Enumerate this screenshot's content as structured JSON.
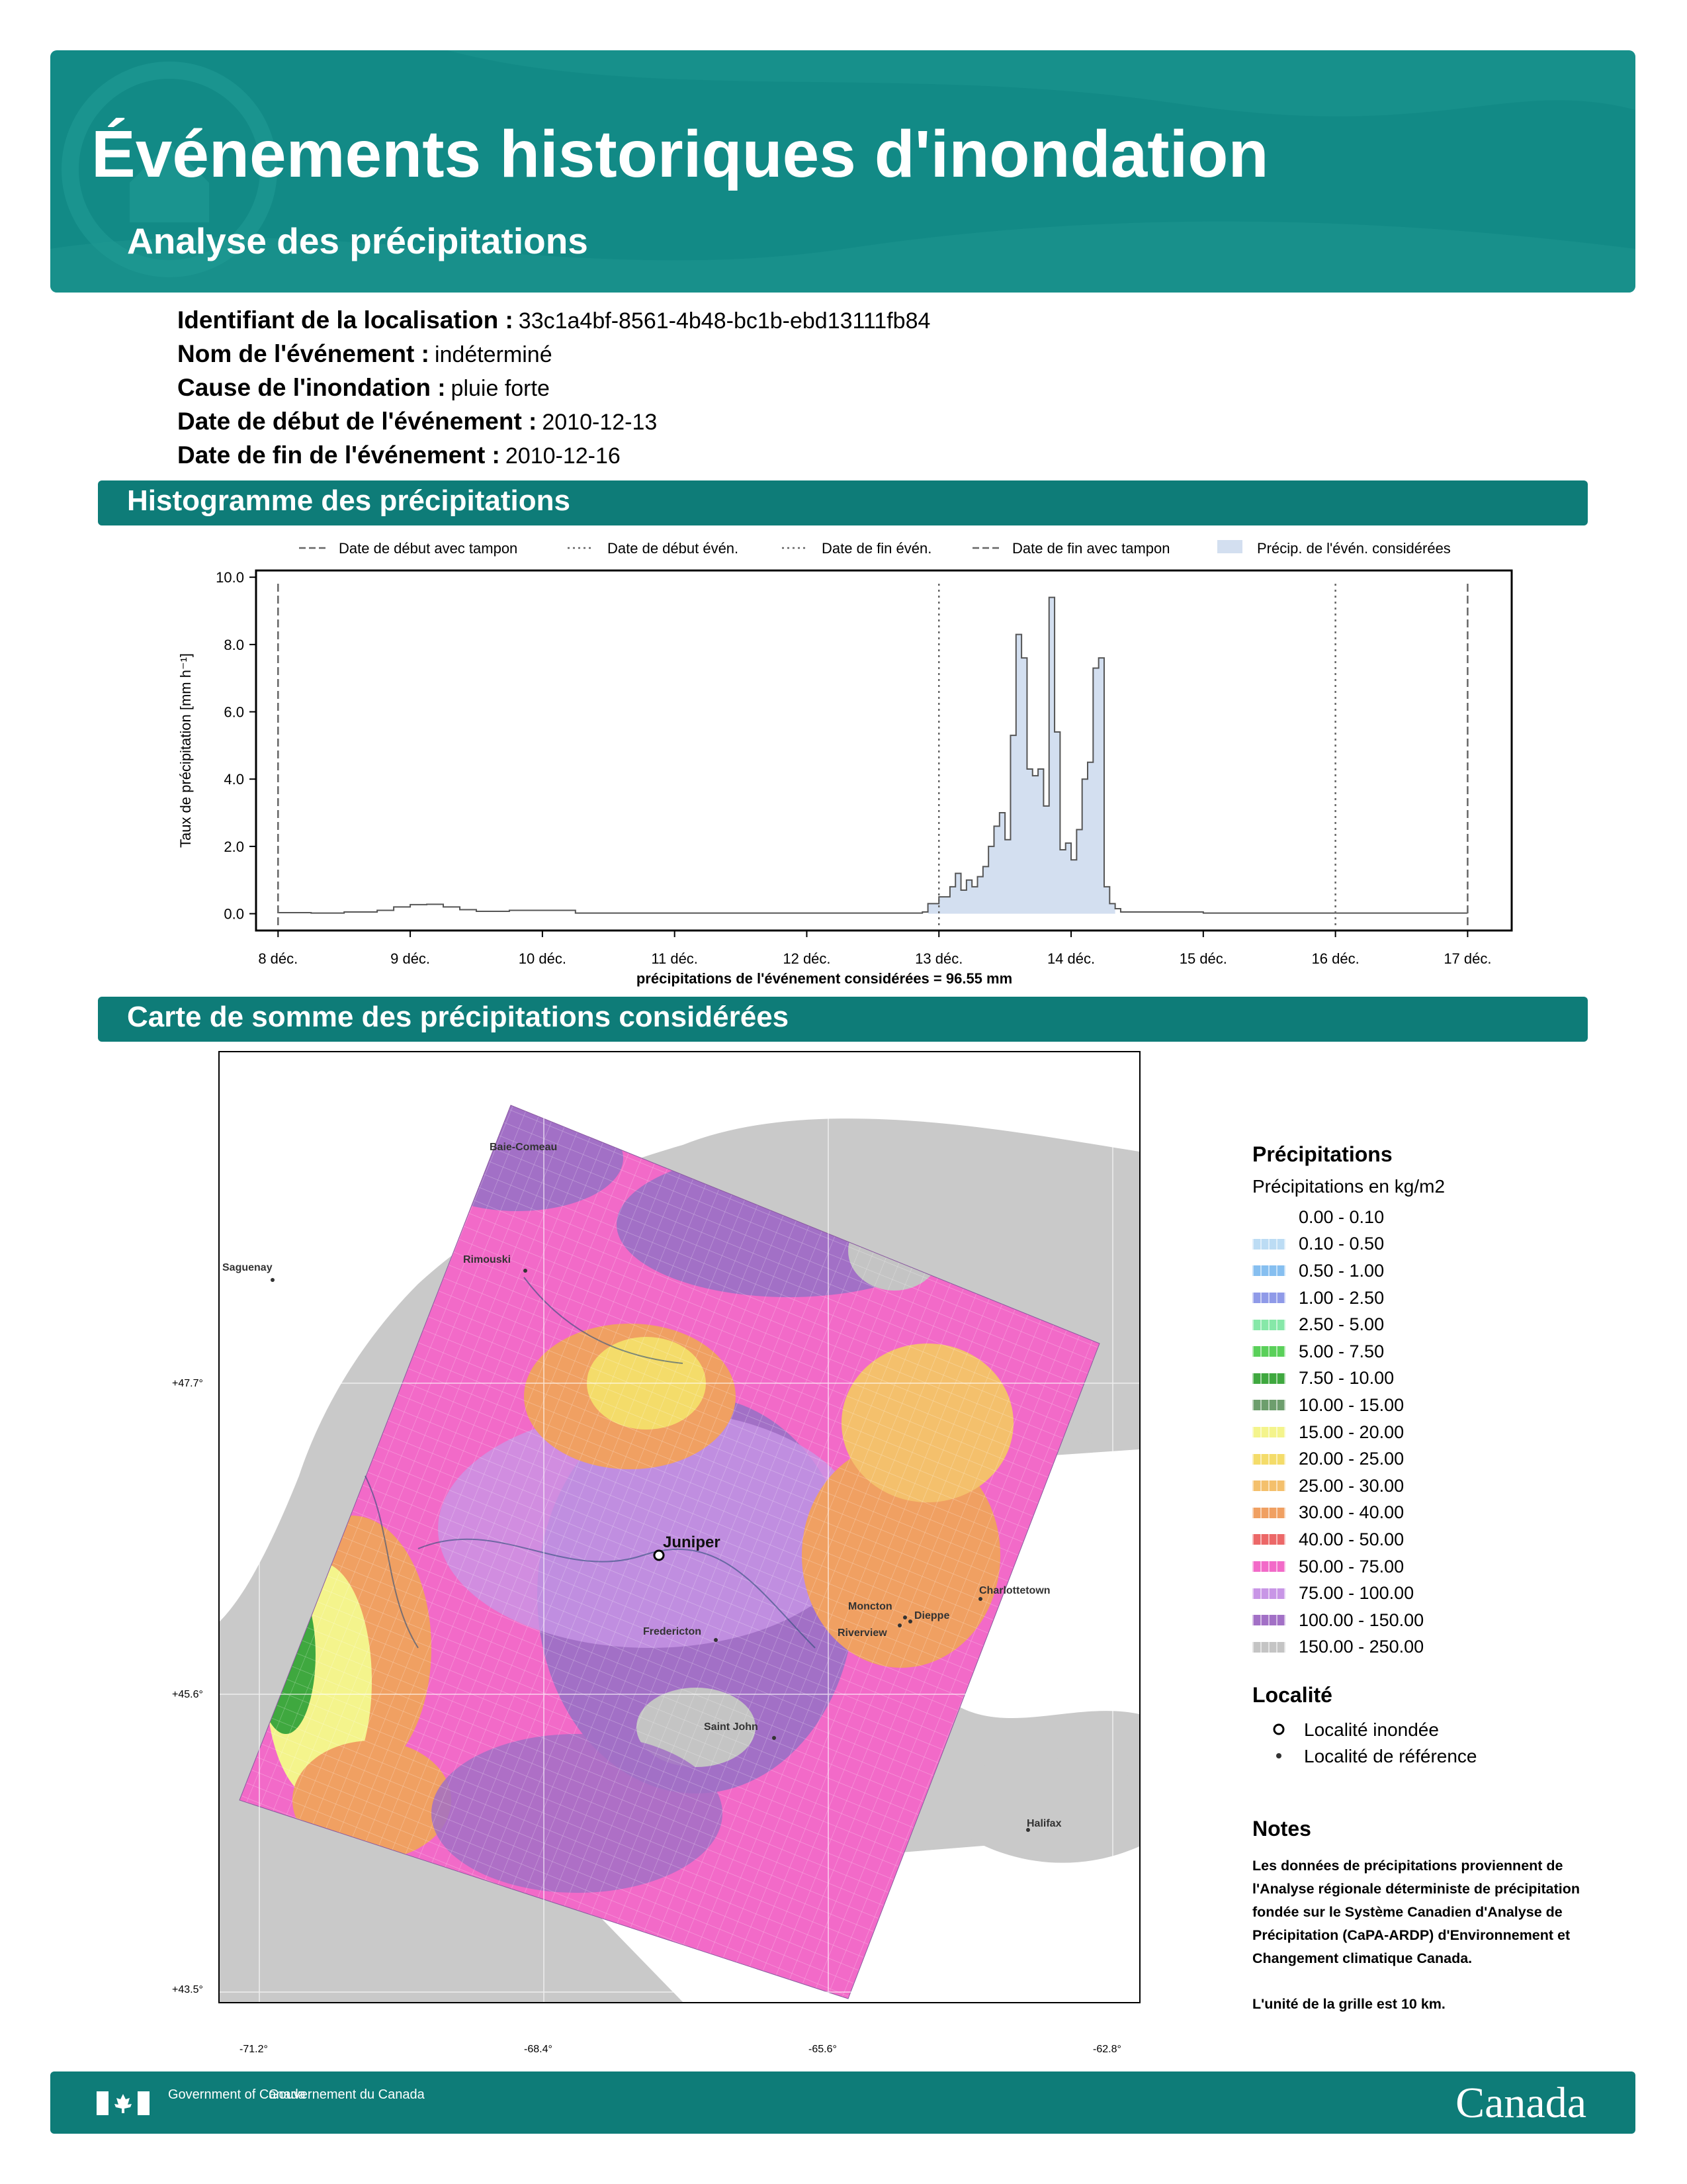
{
  "header": {
    "title": "Événements historiques d'inondation",
    "subtitle": "Analyse des précipitations",
    "bg_color": "#128a86"
  },
  "info": [
    {
      "label": "Identifiant de la localisation :",
      "value": "33c1a4bf-8561-4b48-bc1b-ebd13111fb84"
    },
    {
      "label": "Nom de l'événement :",
      "value": "indéterminé"
    },
    {
      "label": "Cause de l'inondation :",
      "value": "pluie forte"
    },
    {
      "label": "Date de début de l'événement :",
      "value": "2010-12-13"
    },
    {
      "label": "Date de fin de l'événement :",
      "value": "2010-12-16"
    }
  ],
  "sections": {
    "histogram": "Histogramme des précipitations",
    "map": "Carte de somme des précipitations considérées"
  },
  "chart_data": {
    "type": "area",
    "legend": [
      {
        "name": "Date de début avec tampon",
        "style": "dashed"
      },
      {
        "name": "Date de début évén.",
        "style": "dotted"
      },
      {
        "name": "Date de fin évén.",
        "style": "dotted"
      },
      {
        "name": "Date de fin avec tampon",
        "style": "dashed"
      },
      {
        "name": "Précip. de l'évén. considérées",
        "style": "fill"
      }
    ],
    "legend_position": "top",
    "ylabel": "Taux de précipitation [mm h⁻¹]",
    "xlabel": "précipitations de l'événement considérées = 96.55 mm",
    "xlim": [
      "2010-12-07 20:00",
      "2010-12-17 08:00"
    ],
    "ylim": [
      -0.5,
      10.2
    ],
    "y_ticks": [
      "0.0",
      "2.0",
      "4.0",
      "6.0",
      "8.0",
      "10.0"
    ],
    "x_ticks": [
      {
        "date": "2010-12-08",
        "label": "8 déc."
      },
      {
        "date": "2010-12-09",
        "label": "9 déc."
      },
      {
        "date": "2010-12-10",
        "label": "10 déc."
      },
      {
        "date": "2010-12-11",
        "label": "11 déc."
      },
      {
        "date": "2010-12-12",
        "label": "12 déc."
      },
      {
        "date": "2010-12-13",
        "label": "13 déc."
      },
      {
        "date": "2010-12-14",
        "label": "14 déc."
      },
      {
        "date": "2010-12-15",
        "label": "15 déc."
      },
      {
        "date": "2010-12-16",
        "label": "16 déc."
      },
      {
        "date": "2010-12-17",
        "label": "17 déc."
      }
    ],
    "vlines": [
      {
        "date": "2010-12-08 00:00",
        "style": "dashed"
      },
      {
        "date": "2010-12-13 00:00",
        "style": "dotted"
      },
      {
        "date": "2010-12-16 00:00",
        "style": "dotted"
      },
      {
        "date": "2010-12-17 00:00",
        "style": "dashed"
      }
    ],
    "series": [
      {
        "points": [
          [
            "2010-12-08 00:00",
            0.03
          ],
          [
            "2010-12-08 06:00",
            0.02
          ],
          [
            "2010-12-08 12:00",
            0.05
          ],
          [
            "2010-12-08 18:00",
            0.1
          ],
          [
            "2010-12-08 21:00",
            0.2
          ],
          [
            "2010-12-09 00:00",
            0.27
          ],
          [
            "2010-12-09 03:00",
            0.28
          ],
          [
            "2010-12-09 06:00",
            0.2
          ],
          [
            "2010-12-09 09:00",
            0.12
          ],
          [
            "2010-12-09 12:00",
            0.07
          ],
          [
            "2010-12-09 18:00",
            0.1
          ],
          [
            "2010-12-10 00:00",
            0.1
          ],
          [
            "2010-12-10 06:00",
            0.02
          ],
          [
            "2010-12-11 00:00",
            0.02
          ],
          [
            "2010-12-12 00:00",
            0.02
          ],
          [
            "2010-12-12 21:00",
            0.05
          ],
          [
            "2010-12-12 22:00",
            0.3
          ],
          [
            "2010-12-13 00:00",
            0.5
          ],
          [
            "2010-12-13 02:00",
            0.8
          ],
          [
            "2010-12-13 03:00",
            1.2
          ],
          [
            "2010-12-13 04:00",
            0.7
          ],
          [
            "2010-12-13 05:00",
            1.0
          ],
          [
            "2010-12-13 06:00",
            0.8
          ],
          [
            "2010-12-13 07:00",
            1.1
          ],
          [
            "2010-12-13 08:00",
            1.4
          ],
          [
            "2010-12-13 09:00",
            2.0
          ],
          [
            "2010-12-13 10:00",
            2.6
          ],
          [
            "2010-12-13 11:00",
            3.0
          ],
          [
            "2010-12-13 12:00",
            2.2
          ],
          [
            "2010-12-13 13:00",
            5.3
          ],
          [
            "2010-12-13 14:00",
            8.3
          ],
          [
            "2010-12-13 15:00",
            7.6
          ],
          [
            "2010-12-13 16:00",
            4.3
          ],
          [
            "2010-12-13 17:00",
            4.1
          ],
          [
            "2010-12-13 18:00",
            4.3
          ],
          [
            "2010-12-13 19:00",
            3.2
          ],
          [
            "2010-12-13 20:00",
            9.4
          ],
          [
            "2010-12-13 21:00",
            5.4
          ],
          [
            "2010-12-13 22:00",
            1.9
          ],
          [
            "2010-12-13 23:00",
            2.1
          ],
          [
            "2010-12-14 00:00",
            1.6
          ],
          [
            "2010-12-14 01:00",
            2.5
          ],
          [
            "2010-12-14 02:00",
            4.0
          ],
          [
            "2010-12-14 03:00",
            4.5
          ],
          [
            "2010-12-14 04:00",
            7.3
          ],
          [
            "2010-12-14 05:00",
            7.6
          ],
          [
            "2010-12-14 06:00",
            0.8
          ],
          [
            "2010-12-14 07:00",
            0.3
          ],
          [
            "2010-12-14 08:00",
            0.15
          ],
          [
            "2010-12-14 09:00",
            0.05
          ],
          [
            "2010-12-15 00:00",
            0.02
          ],
          [
            "2010-12-16 00:00",
            0.02
          ],
          [
            "2010-12-17 00:00",
            0.02
          ]
        ],
        "highlight": [
          "2010-12-12 22:00",
          "2010-12-14 08:00"
        ],
        "line_color": "#555555",
        "fill_color": "#d3dff0"
      }
    ]
  },
  "map": {
    "coords": {
      "lon_1": "-71.2°",
      "lon_2": "-68.4°",
      "lon_3": "-65.6°",
      "lon_4": "-62.8°",
      "lat_1": "+47.7°",
      "lat_2": "+45.6°",
      "lat_3": "+43.5°"
    },
    "places": {
      "baie_comeau": "Baie-Comeau",
      "saguenay": "Saguenay",
      "rimouski": "Rimouski",
      "juniper": "Juniper",
      "fredericton": "Fredericton",
      "saint_john": "Saint John",
      "moncton": "Moncton",
      "dieppe": "Dieppe",
      "riverview": "Riverview",
      "charlottetown": "Charlottetown",
      "halifax": "Halifax"
    }
  },
  "legend": {
    "title": "Précipitations",
    "subtitle": "Précipitations en kg/m2",
    "classes": [
      {
        "label": "0.00 - 0.10",
        "color": "#ffffff"
      },
      {
        "label": "0.10 - 0.50",
        "color": "#bcdcf4"
      },
      {
        "label": "0.50 - 1.00",
        "color": "#86bff0"
      },
      {
        "label": "1.00 - 2.50",
        "color": "#8f9ae8"
      },
      {
        "label": "2.50 - 5.00",
        "color": "#86e8a8"
      },
      {
        "label": "5.00 - 7.50",
        "color": "#5ad05a"
      },
      {
        "label": "7.50 - 10.00",
        "color": "#3fa83f"
      },
      {
        "label": "10.00 - 15.00",
        "color": "#6d9e6d"
      },
      {
        "label": "15.00 - 20.00",
        "color": "#f4f48c"
      },
      {
        "label": "20.00 - 25.00",
        "color": "#f4dc6a"
      },
      {
        "label": "25.00 - 30.00",
        "color": "#f4c06c"
      },
      {
        "label": "30.00 - 40.00",
        "color": "#f0a062"
      },
      {
        "label": "40.00 - 50.00",
        "color": "#ec6868"
      },
      {
        "label": "50.00 - 75.00",
        "color": "#f26ac8"
      },
      {
        "label": "75.00 - 100.00",
        "color": "#c896e6"
      },
      {
        "label": "100.00 - 150.00",
        "color": "#a270c6"
      },
      {
        "label": "150.00 - 250.00",
        "color": "#c4c4c4"
      }
    ],
    "locality_title": "Localité",
    "flooded_locality": "Localité inondée",
    "reference_locality": "Localité de référence"
  },
  "notes": {
    "title": "Notes",
    "text1": "Les données de précipitations proviennent de l'Analyse régionale déterministe de précipitation fondée sur le Système Canadien d'Analyse de Précipitation (CaPA-ARDP) d'Environnement et Changement climatique Canada.",
    "text2": "L'unité de la grille est 10 km."
  },
  "footer": {
    "gov_en": "Government of Canada",
    "gov_fr": "Gouvernement du Canada",
    "wordmark": "Canada"
  }
}
